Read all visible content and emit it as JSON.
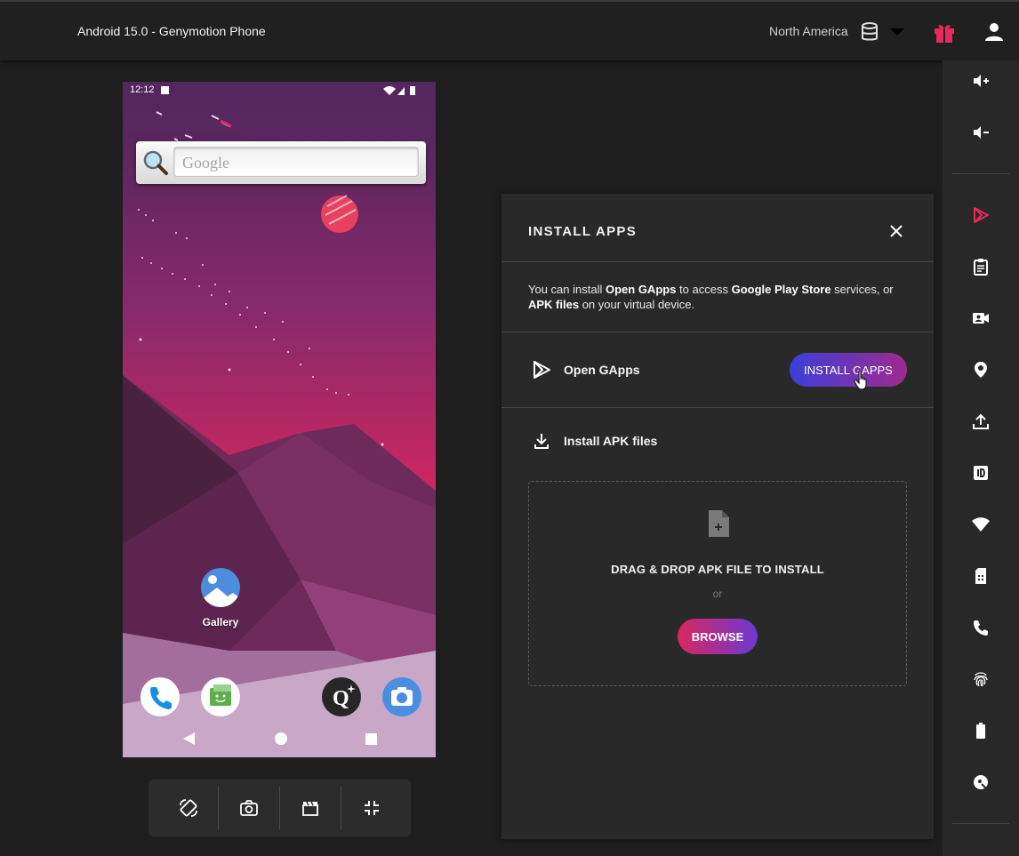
{
  "topbar": {
    "title": "Android 15.0 - Genymotion Phone",
    "region": "North America"
  },
  "colors": {
    "accent_pink": "#e8295f",
    "background": "#1e1e1e",
    "panel": "#292929"
  },
  "sidebar": {
    "items": [
      {
        "name": "volume-up-icon"
      },
      {
        "name": "volume-down-icon"
      },
      {
        "name": "open-gapps-icon"
      },
      {
        "name": "clipboard-icon"
      },
      {
        "name": "camera-icon"
      },
      {
        "name": "gps-location-icon"
      },
      {
        "name": "upload-icon"
      },
      {
        "name": "device-id-icon"
      },
      {
        "name": "wifi-icon"
      },
      {
        "name": "sim-card-icon"
      },
      {
        "name": "phone-call-icon"
      },
      {
        "name": "fingerprint-icon"
      },
      {
        "name": "battery-icon"
      },
      {
        "name": "disk-icon"
      }
    ]
  },
  "phone": {
    "clock": "12:12",
    "search_placeholder": "Google",
    "apps": {
      "gallery": "Gallery"
    }
  },
  "install_panel": {
    "title": "INSTALL APPS",
    "description": {
      "p1": "You can install ",
      "b1": "Open GApps",
      "p2": " to access ",
      "b2": "Google Play Store",
      "p3": " services, or ",
      "b3": "APK files",
      "p4": " on your virtual device."
    },
    "gapps_label": "Open GApps",
    "gapps_button": "INSTALL GAPPS",
    "apk_label": "Install APK files",
    "dropzone_title": "DRAG & DROP APK FILE TO INSTALL",
    "dropzone_or": "or",
    "browse_button": "BROWSE"
  }
}
